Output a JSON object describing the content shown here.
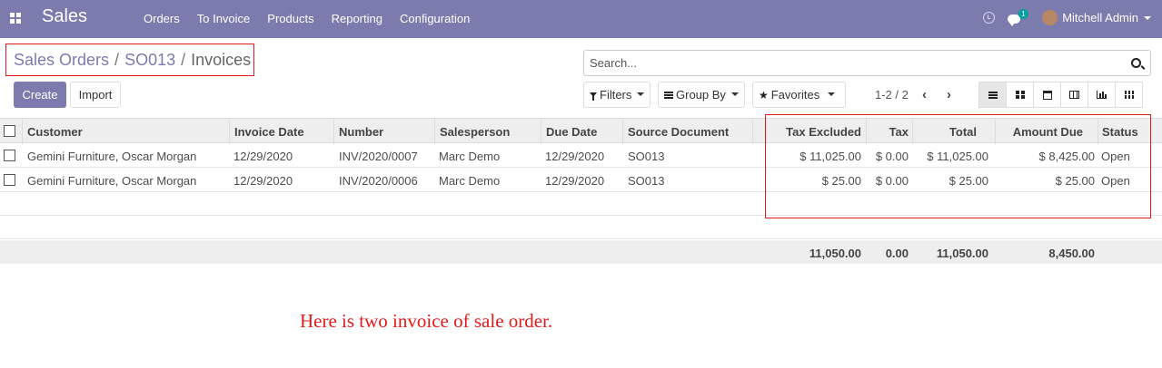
{
  "navbar": {
    "app_name": "Sales",
    "menu": [
      "Orders",
      "To Invoice",
      "Products",
      "Reporting",
      "Configuration"
    ],
    "chat_count": "1",
    "user": "Mitchell Admin"
  },
  "breadcrumb": {
    "items": [
      "Sales Orders",
      "SO013",
      "Invoices"
    ],
    "separator": "/"
  },
  "buttons": {
    "create": "Create",
    "import": "Import"
  },
  "search": {
    "placeholder": "Search..."
  },
  "filters": {
    "filters": "Filters",
    "group_by": "Group By",
    "favorites": "Favorites"
  },
  "pager": {
    "range": "1-2 / 2"
  },
  "table": {
    "columns": {
      "customer": "Customer",
      "invoice_date": "Invoice Date",
      "number": "Number",
      "salesperson": "Salesperson",
      "due_date": "Due Date",
      "source_document": "Source Document",
      "tax_excluded": "Tax Excluded",
      "tax": "Tax",
      "total": "Total",
      "amount_due": "Amount Due",
      "status": "Status"
    },
    "rows": [
      {
        "customer": "Gemini Furniture, Oscar Morgan",
        "invoice_date": "12/29/2020",
        "number": "INV/2020/0007",
        "salesperson": "Marc Demo",
        "due_date": "12/29/2020",
        "source_document": "SO013",
        "tax_excluded": "$ 11,025.00",
        "tax": "$ 0.00",
        "total": "$ 11,025.00",
        "amount_due": "$ 8,425.00",
        "status": "Open"
      },
      {
        "customer": "Gemini Furniture, Oscar Morgan",
        "invoice_date": "12/29/2020",
        "number": "INV/2020/0006",
        "salesperson": "Marc Demo",
        "due_date": "12/29/2020",
        "source_document": "SO013",
        "tax_excluded": "$ 25.00",
        "tax": "$ 0.00",
        "total": "$ 25.00",
        "amount_due": "$ 25.00",
        "status": "Open"
      }
    ],
    "totals": {
      "tax_excluded": "11,050.00",
      "tax": "0.00",
      "total": "11,050.00",
      "amount_due": "8,450.00"
    }
  },
  "annotation": {
    "note": "Here is two invoice of sale order.",
    "highlight_color": "#e21a1a"
  },
  "colors": {
    "navbar": "#7c7bad",
    "primary_button": "#7c7bad"
  }
}
